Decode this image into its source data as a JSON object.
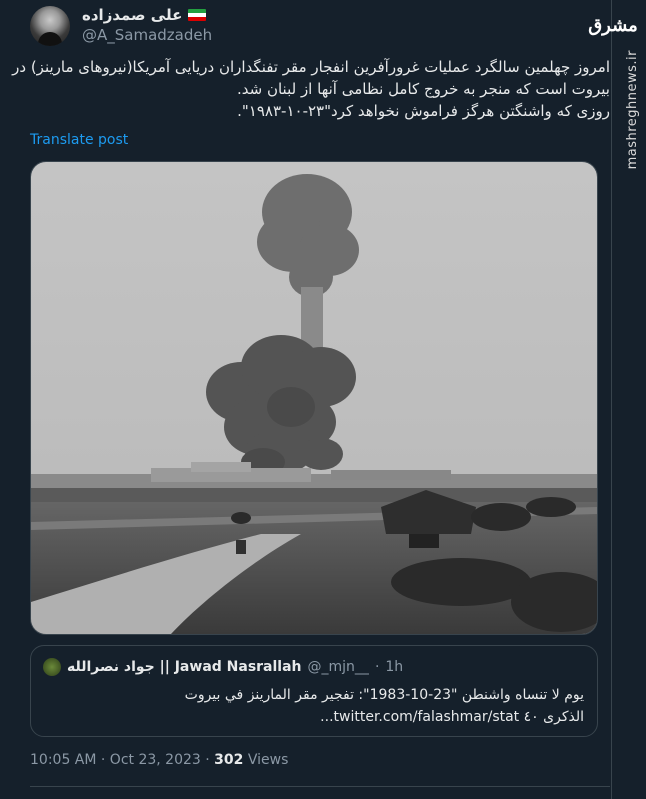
{
  "author": {
    "display_name": "علی صمدزاده",
    "handle": "@A_Samadzadeh",
    "flag_colors": [
      "#239f40",
      "#ffffff",
      "#da0000"
    ]
  },
  "tweet": {
    "lines": [
      "امروز چهلمین سالگرد عملیات غرورآفرین انفجار مقر تفنگداران دریایی آمریکا(نیروهای مارینز) در",
      "بیروت است که منجر به خروج کامل نظامی آنها از لبنان شد.",
      "روزی که واشنگتن هرگز فراموش نخواهد کرد\"۲۳-۱۰-۱۹۸۳\"."
    ],
    "translate_label": "Translate post",
    "timestamp": "10:05 AM · Oct 23, 2023",
    "views_count": "302",
    "views_label": "Views"
  },
  "quoted": {
    "display_name": "جواد نصرالله || Jawad Nasrallah",
    "handle": "@_mjn__",
    "dot": "·",
    "time": "1h",
    "lines": [
      "يوم لا تنساه واشنطن \"23-10-1983\": تفجير مقر المارينز في بيروت",
      "الذكرى ٤٠ twitter.com/falashmar/stat..."
    ]
  },
  "watermark": {
    "logo_text": "مشرق",
    "url": "mashreghnews.ir"
  },
  "colors": {
    "background": "#15202b",
    "link": "#1d9bf0",
    "secondary": "#8b98a5"
  }
}
